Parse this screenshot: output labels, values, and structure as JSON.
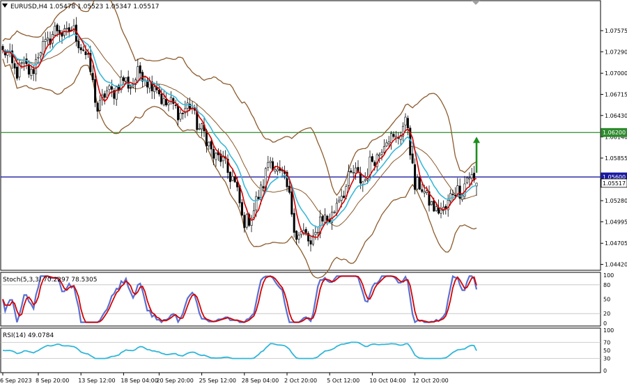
{
  "header": {
    "symbol_line": "EURUSD,H4  1.05478 1.05523 1.05347 1.05517",
    "stoch_label": "Stoch(5,3,3) 70.2297 78.5305",
    "rsi_label": "RSI(14) 49.0784"
  },
  "colors": {
    "bull_candle": "#ffffff",
    "bear_candle": "#000000",
    "sma_red": "#d40000",
    "ema_cyan": "#3ab8d8",
    "bollinger": "#8b5a2b",
    "level_green": "#2e8b2e",
    "level_blue": "#1a1aa0",
    "arrow_green": "#1e8e1e",
    "stoch_main": "#5a6fd0",
    "stoch_signal": "#d40000",
    "rsi_line": "#2fb6d9",
    "grid": "#c0c0c0"
  },
  "price_axis": {
    "ticks": [
      "1.07575",
      "1.07290",
      "1.07000",
      "1.06715",
      "1.06430",
      "1.06140",
      "1.05855",
      "1.05280",
      "1.04995",
      "1.04705",
      "1.04420"
    ],
    "tick_values": [
      1.07575,
      1.0729,
      1.07,
      1.06715,
      1.0643,
      1.0614,
      1.05855,
      1.0528,
      1.04995,
      1.04705,
      1.0442
    ],
    "ylim": [
      1.0435,
      1.0797
    ],
    "levels": [
      {
        "value": 1.062,
        "label": "1.06200",
        "kind": "green"
      },
      {
        "value": 1.056,
        "label": "1.05600",
        "kind": "blue"
      },
      {
        "value": 1.05517,
        "label": "1.05517",
        "kind": "price"
      }
    ]
  },
  "stoch_axis": {
    "ticks": [
      "100",
      "80",
      "50",
      "20",
      "0"
    ],
    "tick_values": [
      100,
      80,
      50,
      20,
      0
    ],
    "levels": [
      80,
      20
    ]
  },
  "rsi_axis": {
    "ticks": [
      "100",
      "70",
      "50",
      "30",
      "0"
    ],
    "tick_values": [
      100,
      70,
      50,
      30,
      0
    ],
    "levels": [
      70,
      30
    ]
  },
  "time_axis": {
    "labels": [
      "6 Sep 2023",
      "8 Sep 20:00",
      "13 Sep 12:00",
      "18 Sep 04:00",
      "20 Sep 20:00",
      "25 Sep 12:00",
      "28 Sep 04:00",
      "2 Oct 20:00",
      "5 Oct 12:00",
      "10 Oct 04:00",
      "12 Oct 20:00"
    ],
    "bar_index": [
      0,
      15,
      33,
      51,
      66,
      84,
      102,
      120,
      138,
      156,
      174
    ]
  },
  "chart_data": {
    "type": "candlestick",
    "symbol": "EURUSD",
    "timeframe": "H4",
    "last_bar": {
      "open": 1.05478,
      "high": 1.05523,
      "low": 1.05347,
      "close": 1.05517
    },
    "price_path_keypoints": [
      {
        "bar": 0,
        "price": 1.0728
      },
      {
        "bar": 6,
        "price": 1.0705
      },
      {
        "bar": 12,
        "price": 1.0705
      },
      {
        "bar": 20,
        "price": 1.0752
      },
      {
        "bar": 28,
        "price": 1.0758
      },
      {
        "bar": 34,
        "price": 1.0738
      },
      {
        "bar": 40,
        "price": 1.0656
      },
      {
        "bar": 48,
        "price": 1.0684
      },
      {
        "bar": 55,
        "price": 1.069
      },
      {
        "bar": 60,
        "price": 1.07
      },
      {
        "bar": 66,
        "price": 1.0672
      },
      {
        "bar": 72,
        "price": 1.0651
      },
      {
        "bar": 80,
        "price": 1.0651
      },
      {
        "bar": 86,
        "price": 1.0607
      },
      {
        "bar": 92,
        "price": 1.058
      },
      {
        "bar": 97,
        "price": 1.0563
      },
      {
        "bar": 101,
        "price": 1.0503
      },
      {
        "bar": 106,
        "price": 1.051
      },
      {
        "bar": 112,
        "price": 1.058
      },
      {
        "bar": 118,
        "price": 1.0565
      },
      {
        "bar": 124,
        "price": 1.0487
      },
      {
        "bar": 130,
        "price": 1.047
      },
      {
        "bar": 134,
        "price": 1.0499
      },
      {
        "bar": 140,
        "price": 1.0514
      },
      {
        "bar": 146,
        "price": 1.056
      },
      {
        "bar": 153,
        "price": 1.056
      },
      {
        "bar": 160,
        "price": 1.0605
      },
      {
        "bar": 168,
        "price": 1.062
      },
      {
        "bar": 171,
        "price": 1.063
      },
      {
        "bar": 174,
        "price": 1.0549
      },
      {
        "bar": 180,
        "price": 1.0533
      },
      {
        "bar": 183,
        "price": 1.0507
      },
      {
        "bar": 190,
        "price": 1.0535
      },
      {
        "bar": 196,
        "price": 1.0557
      },
      {
        "bar": 200,
        "price": 1.0552
      }
    ],
    "bars_total": 201,
    "indicators": [
      "SMA (red)",
      "EMA (cyan)",
      "Bollinger Bands (brown)",
      "Stoch(5,3,3)",
      "RSI(14)"
    ],
    "stoch": {
      "main": 70.2297,
      "signal": 78.5305
    },
    "rsi": 49.0784,
    "annotation": "green up arrow toward 1.06200"
  }
}
